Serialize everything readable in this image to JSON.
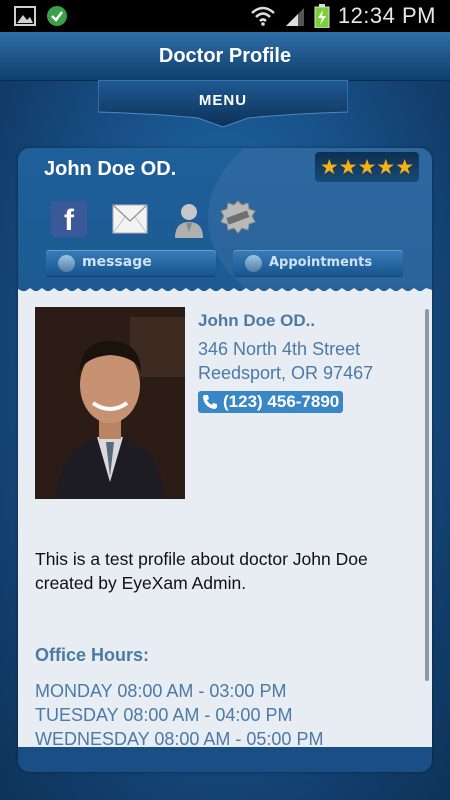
{
  "status_bar": {
    "time": "12:34 PM",
    "icons": [
      "gallery-icon",
      "sync-check-icon",
      "wifi-icon",
      "signal-icon",
      "battery-charging-icon"
    ]
  },
  "header": {
    "title": "Doctor Profile"
  },
  "menu": {
    "label": "MENU"
  },
  "profile": {
    "name": "John  Doe OD.",
    "rating": 5,
    "stars": "★★★★★",
    "social_icons": [
      "facebook-icon",
      "mail-icon",
      "user-icon",
      "promo-badge-icon"
    ],
    "facebook_glyph": "f",
    "message_label": "message",
    "appointments_label": "Appointments"
  },
  "details": {
    "name": "John Doe OD..",
    "address_line1": "346 North 4th Street",
    "address_line2": "Reedsport, OR 97467",
    "phone": "(123) 456-7890",
    "description": "This is a test profile about doctor John Doe created by EyeXam Admin.",
    "office_hours_title": "Office Hours:",
    "office_hours": [
      "MONDAY 08:00 AM - 03:00 PM",
      "TUESDAY 08:00 AM - 04:00 PM",
      "WEDNESDAY 08:00 AM - 05:00 PM"
    ]
  },
  "colors": {
    "accent": "#3a87c6",
    "link_text": "#4b7aa6",
    "star": "#f3b21b"
  }
}
